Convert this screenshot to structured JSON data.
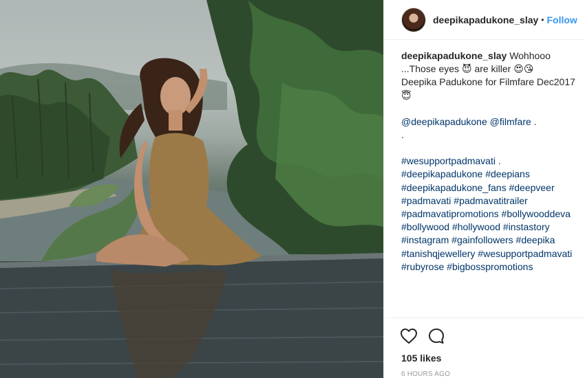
{
  "header": {
    "username": "deepikapadukone_slay",
    "separator": "•",
    "follow_label": "Follow"
  },
  "caption": {
    "username": "deepikapadukone_slay",
    "line1_text": "Wohhooo ...Those eyes",
    "line1_emoji": "😈",
    "line1b_text": "are killer",
    "line1b_emoji": "😍😘",
    "line2_text": "Deepika Padukone for Filmfare Dec2017",
    "line2_emoji": "😇",
    "mentions": [
      "@deepikapadukone",
      "@filmfare",
      "."
    ],
    "dot_line": ".",
    "hashtag_lines": [
      [
        "#wesupportpadmavati",
        "."
      ],
      [
        "#deepikapadukone",
        "#deepians"
      ],
      [
        "#deepikapadukone_fans",
        "#deepveer"
      ],
      [
        "#padmavati",
        "#padmavatitrailer"
      ],
      [
        "#padmavatipromotions",
        "#bollywooddeva"
      ],
      [
        "#bollywood",
        "#hollywood",
        "#instastory"
      ],
      [
        "#instagram",
        "#gainfollowers",
        "#deepika"
      ],
      [
        "#tanishqjewellery",
        "#wesupportpadmavati"
      ],
      [
        "#rubyrose",
        "#bigbosspromotions"
      ]
    ]
  },
  "actions": {
    "like_icon": "heart-icon",
    "comment_icon": "comment-icon",
    "likes_text": "105 likes",
    "time_text": "6 HOURS AGO"
  },
  "colors": {
    "link": "#3897f0",
    "hashtag": "#003569",
    "muted": "#999999"
  }
}
